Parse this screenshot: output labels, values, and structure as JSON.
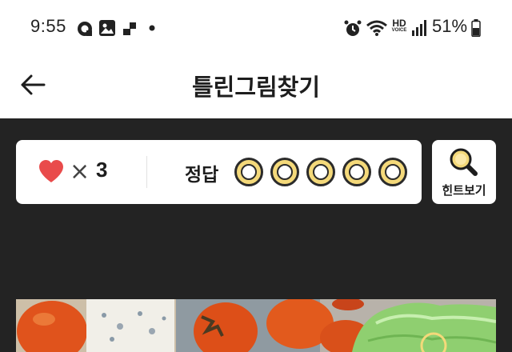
{
  "status_bar": {
    "time": "9:55",
    "battery": "51%",
    "icons": [
      "notification-icon",
      "gallery-icon",
      "app-icon",
      "dot-icon",
      "alarm-icon",
      "wifi-icon",
      "hd-voice-icon",
      "signal-icon",
      "battery-icon"
    ],
    "hd_label": "HD",
    "voice_label": "VOICE"
  },
  "header": {
    "title": "틀린그림찾기",
    "back_icon": "back-arrow-icon"
  },
  "score": {
    "lives_prefix": "×",
    "lives": "3",
    "answer_label": "정답",
    "answers_found": 0,
    "answers_total": 5
  },
  "hint": {
    "label": "힌트보기",
    "icon": "magnifier-icon"
  },
  "colors": {
    "dark_bg": "#232323",
    "accent_yellow": "#f4d97a",
    "heart_red": "#e94b4b"
  }
}
